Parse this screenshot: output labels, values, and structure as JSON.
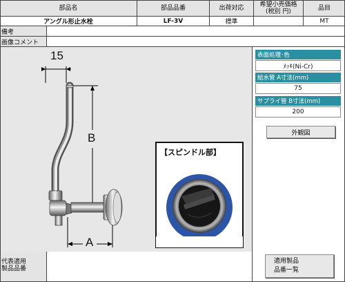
{
  "headers": {
    "part_name": "部品名",
    "part_number": "部品品番",
    "shipping": "出荷対応",
    "price": "希望小売価格\n(税別 円)",
    "category": "品目"
  },
  "product": {
    "name": "アングル形止水栓",
    "number": "LF-3V",
    "shipping": "標準",
    "price": "",
    "category": "MT"
  },
  "rows": {
    "remarks_label": "備考",
    "image_comment_label": "画像コメント"
  },
  "diagram": {
    "dim_15": "15",
    "dim_b": "B",
    "dim_a": "A",
    "spindle_label": "【スピンドル部】"
  },
  "specs": [
    {
      "label": "表面処理･色",
      "value": "ﾒｯｷ(Ni-Cr)"
    },
    {
      "label": "給水管 A寸法(mm)",
      "value": "75"
    },
    {
      "label": "サプライ管 B寸法(mm)",
      "value": "200"
    }
  ],
  "buttons": {
    "external_view": "外観図",
    "applicable_products_line1": "適用製品",
    "applicable_products_line2": "品番一覧"
  },
  "footer": {
    "rep_label": "代表適用\n製品品番"
  }
}
